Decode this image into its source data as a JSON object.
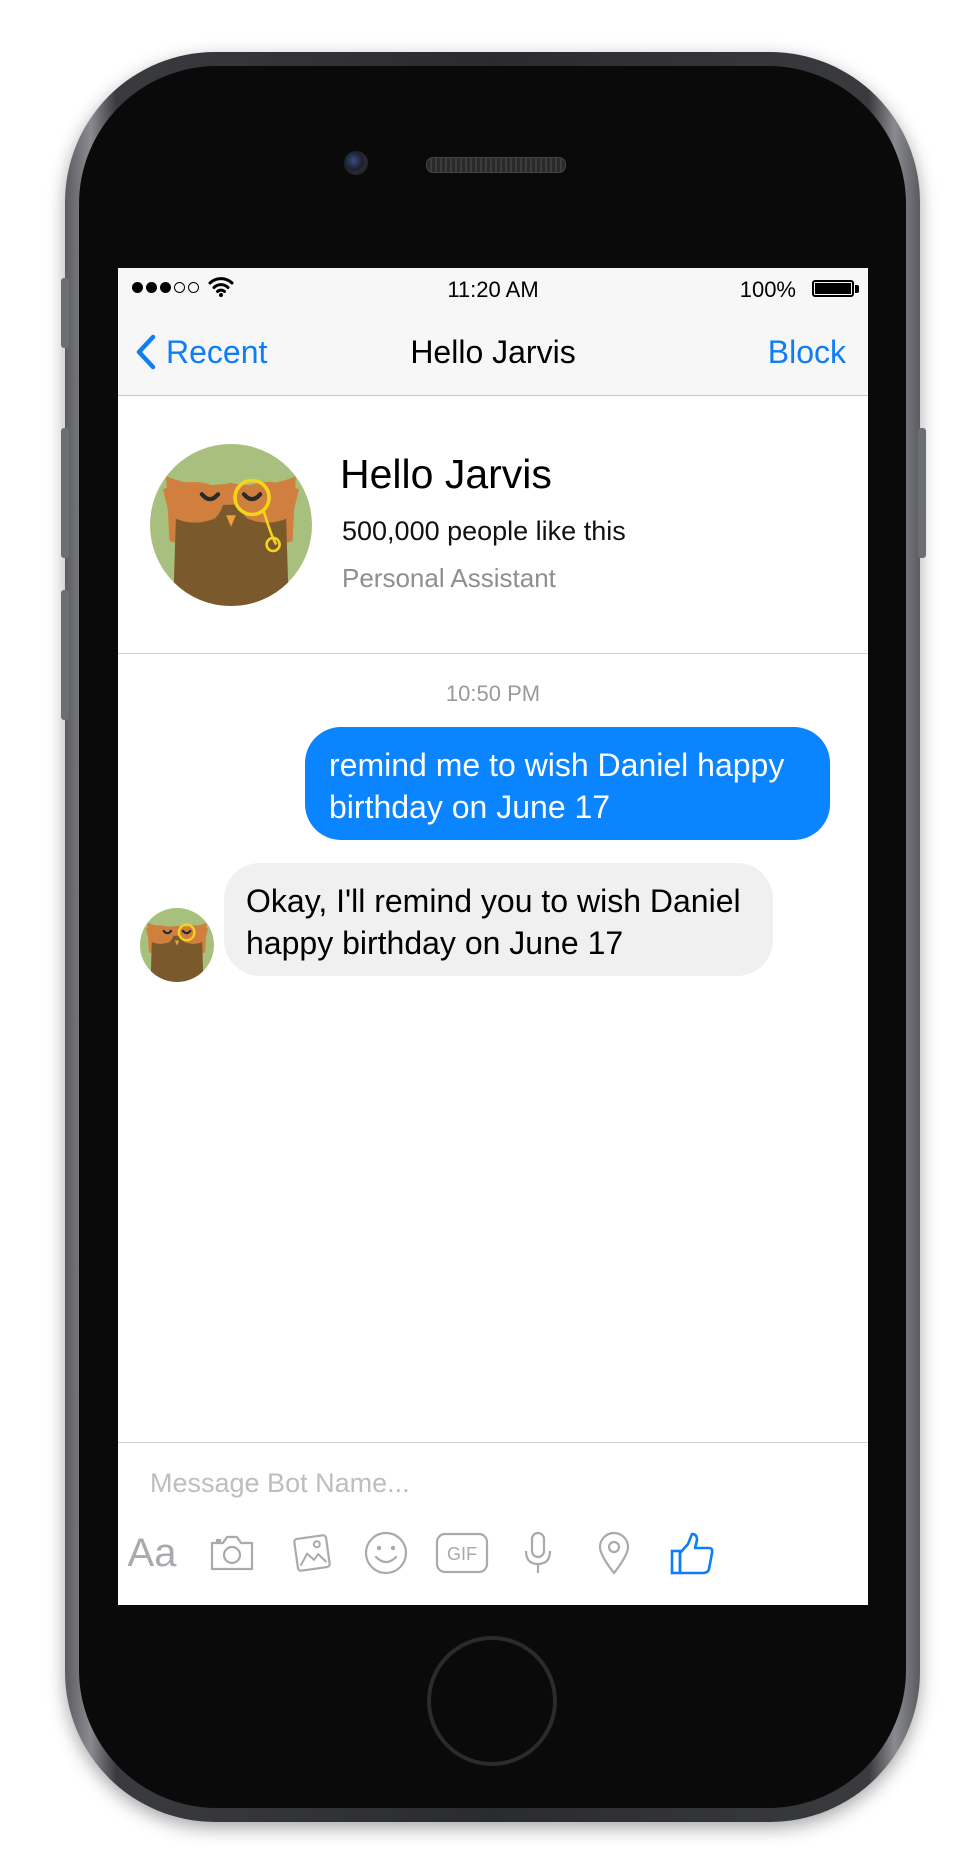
{
  "status_bar": {
    "time": "11:20 AM",
    "battery_percent": "100%",
    "signal_bars": 3,
    "signal_total": 5
  },
  "nav": {
    "back_label": "Recent",
    "title": "Hello Jarvis",
    "block_label": "Block"
  },
  "profile": {
    "name": "Hello Jarvis",
    "likes": "500,000 people like this",
    "category": "Personal Assistant"
  },
  "conversation": {
    "timestamp": "10:50 PM",
    "outgoing_message": "remind me to wish Daniel happy birthday on June 17",
    "incoming_message": "Okay, I'll remind you to wish Daniel happy birthday on June 17"
  },
  "composer": {
    "placeholder": "Message Bot Name...",
    "value": "",
    "text_tool_label": "Aa",
    "gif_label": "GIF"
  },
  "colors": {
    "accent": "#0f7ef6",
    "outgoing_bubble": "#0a84ff",
    "incoming_bubble": "#f1f0f0"
  },
  "icons": [
    "back-chevron-icon",
    "wifi-icon",
    "battery-icon",
    "owl-avatar-icon",
    "camera-icon",
    "photo-gallery-icon",
    "emoji-icon",
    "gif-icon",
    "microphone-icon",
    "location-pin-icon",
    "thumbs-up-icon"
  ]
}
